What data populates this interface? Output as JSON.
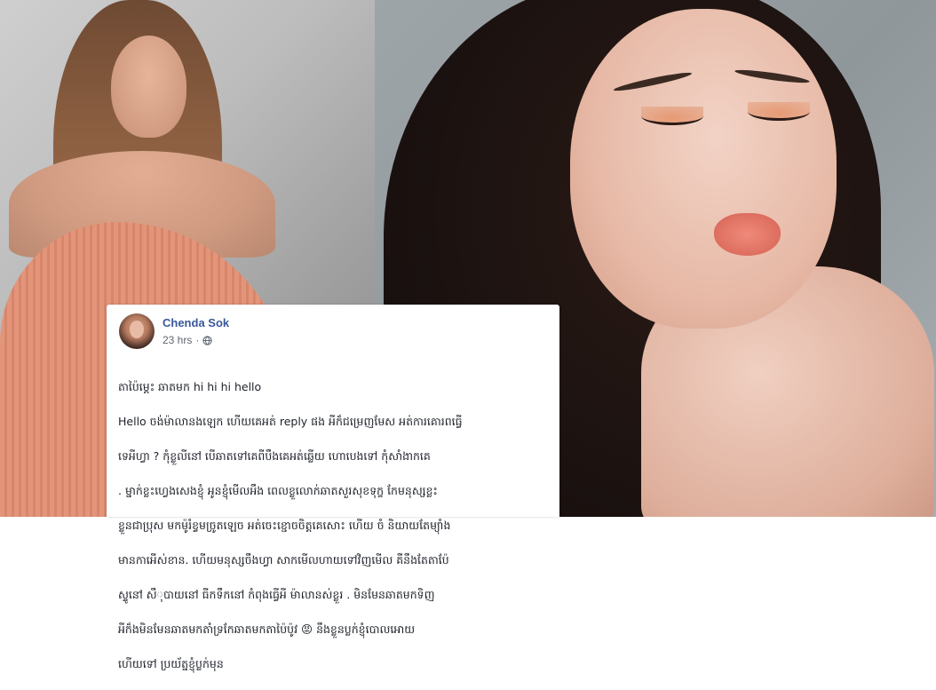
{
  "post": {
    "author": "Chenda Sok",
    "time": "23 hrs",
    "separator": "·",
    "privacy_icon": "globe-icon",
    "line1": "តាប៉ៃម្ដេះ ឆាតមក hi hi hi hello",
    "line2": "Hello ចង់ម៉ាលានងឡេក ហើយគេអត់ reply ផង អីក៏ជម្រេញមែស អត់ការគោរពធ្វើ",
    "line3": "ទេអីហ្វា ? កុំខ្លួលីនៅ បើឆាតទៅគេពីបឹងគេអត់ឆ្លើយ ហោបេងទៅ កុំសាំងាកគេ",
    "line4": ". ម្នាក់ខ្លះហ្វេងសេងខ្ញុំ អូនខ្ញុំមើលអឹង ពេលខ្លួលោក់ឆាតសួរសុខទុក្ខ កែមនុស្សខ្លះ",
    "line5": "ខ្លួនជាប្រុស មកម៉ូរំខ្វមច្រូតឡេច អត់ចេះខ្ជោចចិត្តគេសោះ ហើយ ចំ និយាយតែម្យ៉ាំង",
    "line6": "មានកាអើស់ខាន. ហើយមនុស្សចឹងហ្វា សាកមើលហាយទៅវិញមើល គឺនឹងតែតាប៉ែ",
    "line7": "ស្ទូនៅ សឹុបាយនៅ ធីកទឹកនៅ កំពុងធ្វើអី ម៉ាលានស់ខ្លួរ . មិនមែនឆាតមកទិញ",
    "line8": "អីក៏ងមិនមែនឆាតមកតាំទ្រកែឆាតមកតាប៉ៃប៉ូវ 😡 នឹងខ្លួនប្លក់ខ្ញុំបោលអោយ",
    "line9": "ហើយទៅ ប្រយ័ត្នខ្ញុំប្លក់មុន"
  },
  "colors": {
    "author": "#385898",
    "meta": "#616770",
    "text": "#1d2129",
    "card_bg": "#ffffff"
  }
}
